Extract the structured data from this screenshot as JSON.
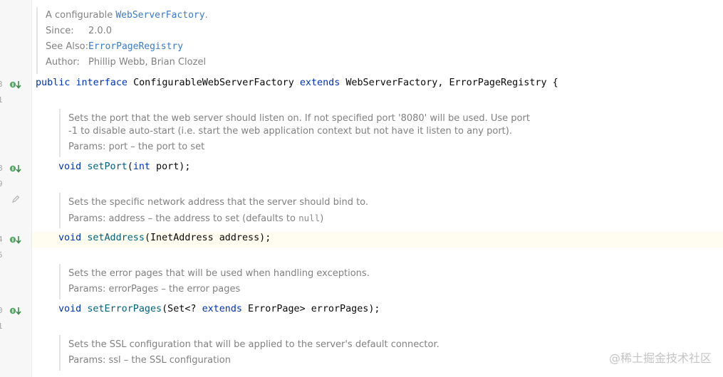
{
  "gutter": {
    "line_numbers": [
      "3",
      "1",
      "8",
      "9",
      "4",
      "5",
      "0",
      "1"
    ]
  },
  "class_doc": {
    "intro_prefix": "A configurable ",
    "intro_link": "WebServerFactory",
    "intro_suffix": ".",
    "since_label": "Since:",
    "since_value": "2.0.0",
    "see_also_label": "See Also:",
    "see_also_link": "ErrorPageRegistry",
    "author_label": "Author:",
    "author_value": "Phillip Webb, Brian Clozel"
  },
  "interface_decl": {
    "kw_public": "public",
    "kw_interface": "interface",
    "name": "ConfigurableWebServerFactory",
    "kw_extends": "extends",
    "parents": "WebServerFactory, ErrorPageRegistry {"
  },
  "methods": [
    {
      "doc_lines": [
        "Sets the port that the web server should listen on. If not specified port '8080' will be used. Use port",
        "-1 to disable auto-start (i.e. start the web application context but not have it listen to any port)."
      ],
      "params": "Params: port – the port to set",
      "ret": "void",
      "name": "setPort",
      "args_open": "(",
      "arg_type": "int",
      "args_rest": " port);"
    },
    {
      "doc_lines": [
        "Sets the specific network address that the server should bind to."
      ],
      "params": "Params: address – the address to set (defaults to ",
      "params_code": "null",
      "params_suffix": ")",
      "ret": "void",
      "name": "setAddress",
      "args": "(InetAddress address);"
    },
    {
      "doc_lines": [
        "Sets the error pages that will be used when handling exceptions."
      ],
      "params": "Params: errorPages – the error pages",
      "ret": "void",
      "name": "setErrorPages",
      "args_open": "(Set<? ",
      "arg_kw": "extends",
      "args_rest": " ErrorPage> errorPages);"
    },
    {
      "doc_lines": [
        "Sets the SSL configuration that will be applied to the server's default connector."
      ],
      "params": "Params: ssl – the SSL configuration"
    }
  ],
  "watermark": "@稀土掘金技术社区",
  "colors": {
    "keyword": "#0033b3",
    "method": "#00627a",
    "link": "#3b7bc5",
    "doc_text": "#818181",
    "gutter_bg": "#f7f7f7",
    "current_line": "#fefdf0"
  }
}
